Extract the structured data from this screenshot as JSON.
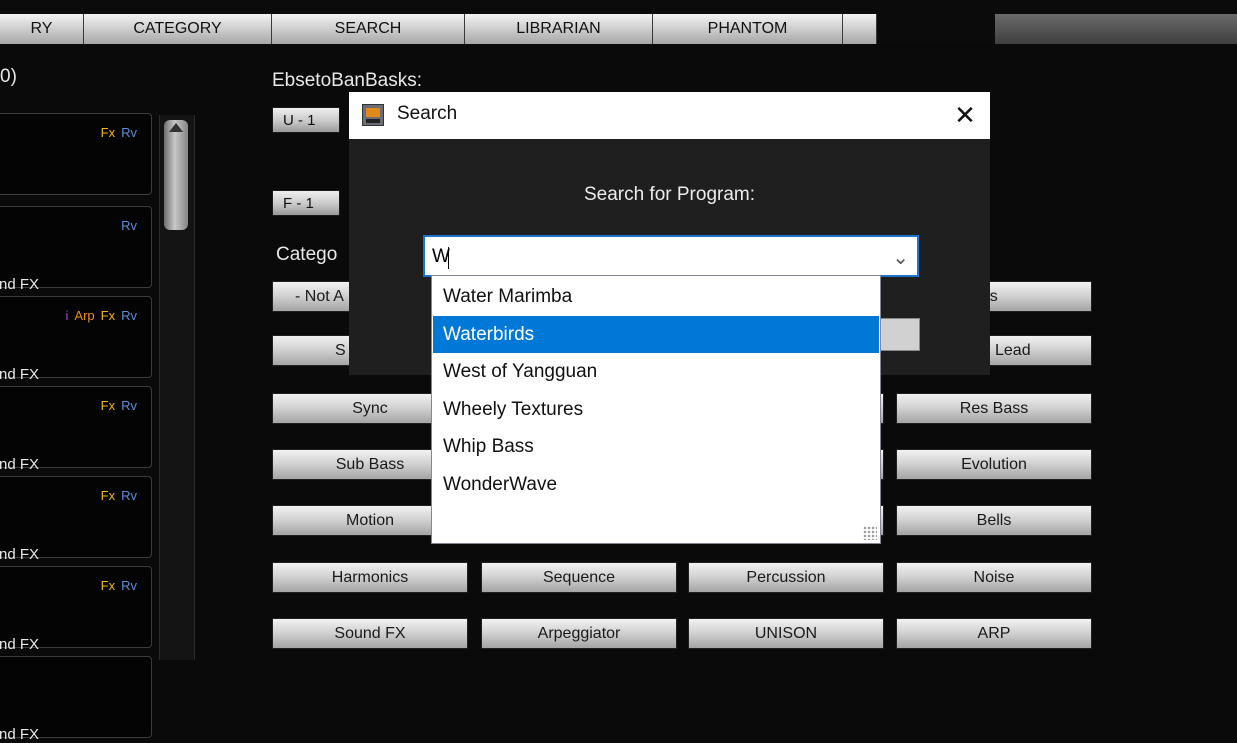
{
  "tabs": [
    "RY",
    "CATEGORY",
    "SEARCH",
    "LIBRARIAN",
    "PHANTOM"
  ],
  "left": {
    "count_label": "0)",
    "slots": [
      {
        "flags": [
          "Fx",
          "Rv"
        ],
        "name": ""
      },
      {
        "flags": [
          "Rv"
        ],
        "name": "nd FX"
      },
      {
        "flags": [
          "i",
          "Arp",
          "Fx",
          "Rv"
        ],
        "name": "nd FX"
      },
      {
        "flags": [
          "Fx",
          "Rv"
        ],
        "name": "nd FX"
      },
      {
        "flags": [
          "Fx",
          "Rv"
        ],
        "name": "nd FX"
      },
      {
        "flags": [
          "Fx",
          "Rv"
        ],
        "name": "nd FX"
      },
      {
        "flags": [],
        "name": "nd FX"
      }
    ]
  },
  "panel": {
    "banks_label": "EbsetoBanBasks:",
    "user_bank": "U - 1",
    "factory_bank": "F - 1",
    "category_label": "Catego",
    "categories": [
      [
        "- Not A",
        "",
        "",
        "ans"
      ],
      [
        "S",
        "",
        "",
        "Lead"
      ],
      [
        "Sync",
        "",
        "",
        "Res Bass"
      ],
      [
        "Sub Bass",
        "",
        "",
        "Evolution"
      ],
      [
        "Motion",
        "",
        "",
        "Bells"
      ],
      [
        "Harmonics",
        "Sequence",
        "Percussion",
        "Noise"
      ],
      [
        "Sound FX",
        "Arpeggiator",
        "UNISON",
        "ARP"
      ]
    ]
  },
  "dialog": {
    "title": "Search",
    "close_glyph": "✕",
    "prompt": "Search for Program:",
    "query": "W",
    "options": [
      "Water Marimba",
      "Waterbirds",
      "West of Yangguan",
      "Wheely Textures",
      "Whip Bass",
      "WonderWave"
    ],
    "highlighted": "Waterbirds"
  }
}
